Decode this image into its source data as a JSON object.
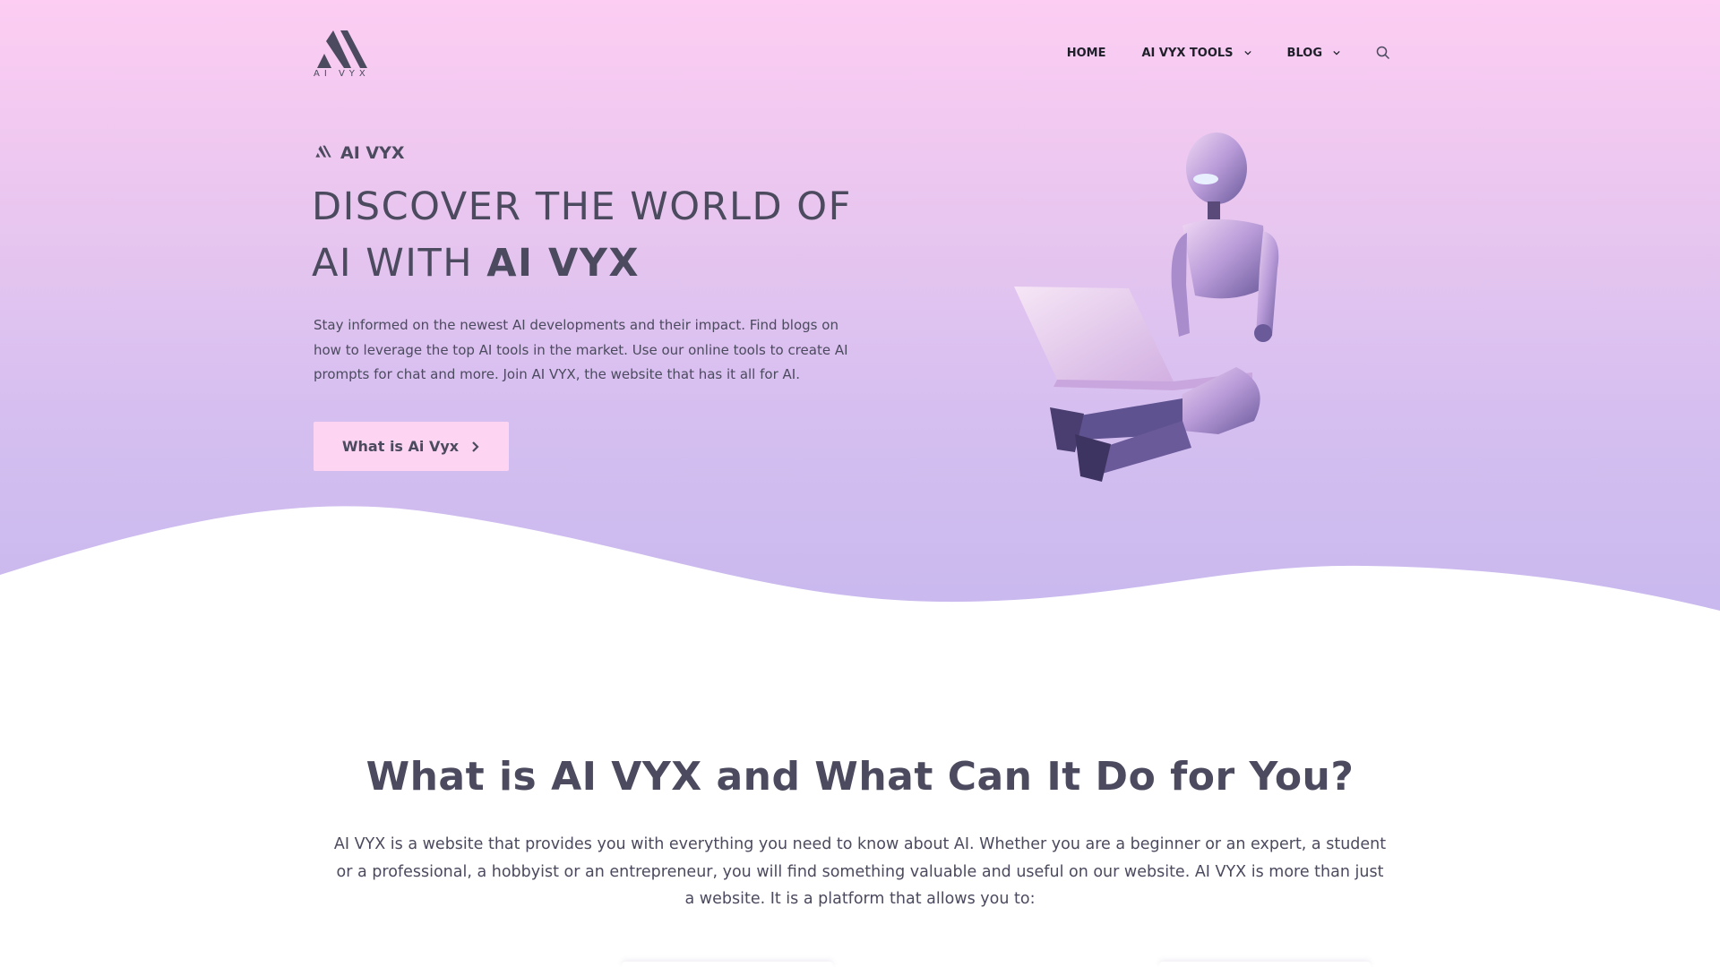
{
  "header": {
    "logo_text": "AI VYX",
    "nav": [
      {
        "label": "HOME",
        "has_dropdown": false
      },
      {
        "label": "AI VYX TOOLS",
        "has_dropdown": true
      },
      {
        "label": "BLOG",
        "has_dropdown": true
      }
    ],
    "search_icon": "search-icon"
  },
  "hero": {
    "brand_name": "AI VYX",
    "title_line1": "DISCOVER THE WORLD OF",
    "title_line2_prefix": "AI WITH ",
    "title_line2_bold": "AI VYX",
    "description": "Stay informed on the newest AI developments and their impact. Find blogs on how to leverage the top AI tools in the market. Use our online tools to create AI prompts for chat and more. Join AI VYX, the website that has it all for AI.",
    "cta_label": "What is Ai Vyx",
    "image": "robot-with-laptop"
  },
  "about": {
    "title": "What is AI VYX and What Can It Do for You?",
    "description": "AI VYX is a website that provides you with everything you need to know about AI. Whether you are a beginner or an expert, a student or a professional, a hobbyist or an entrepreneur, you will find something valuable and useful on our website. AI VYX is more than just a website. It is a platform that allows you to:"
  },
  "colors": {
    "hero_top": "#fdcdf3",
    "hero_bottom": "#c8b8ee",
    "text": "#4b4a5e",
    "nav_text": "#1f1f2a",
    "cta_bg": "#fdd5f3"
  }
}
